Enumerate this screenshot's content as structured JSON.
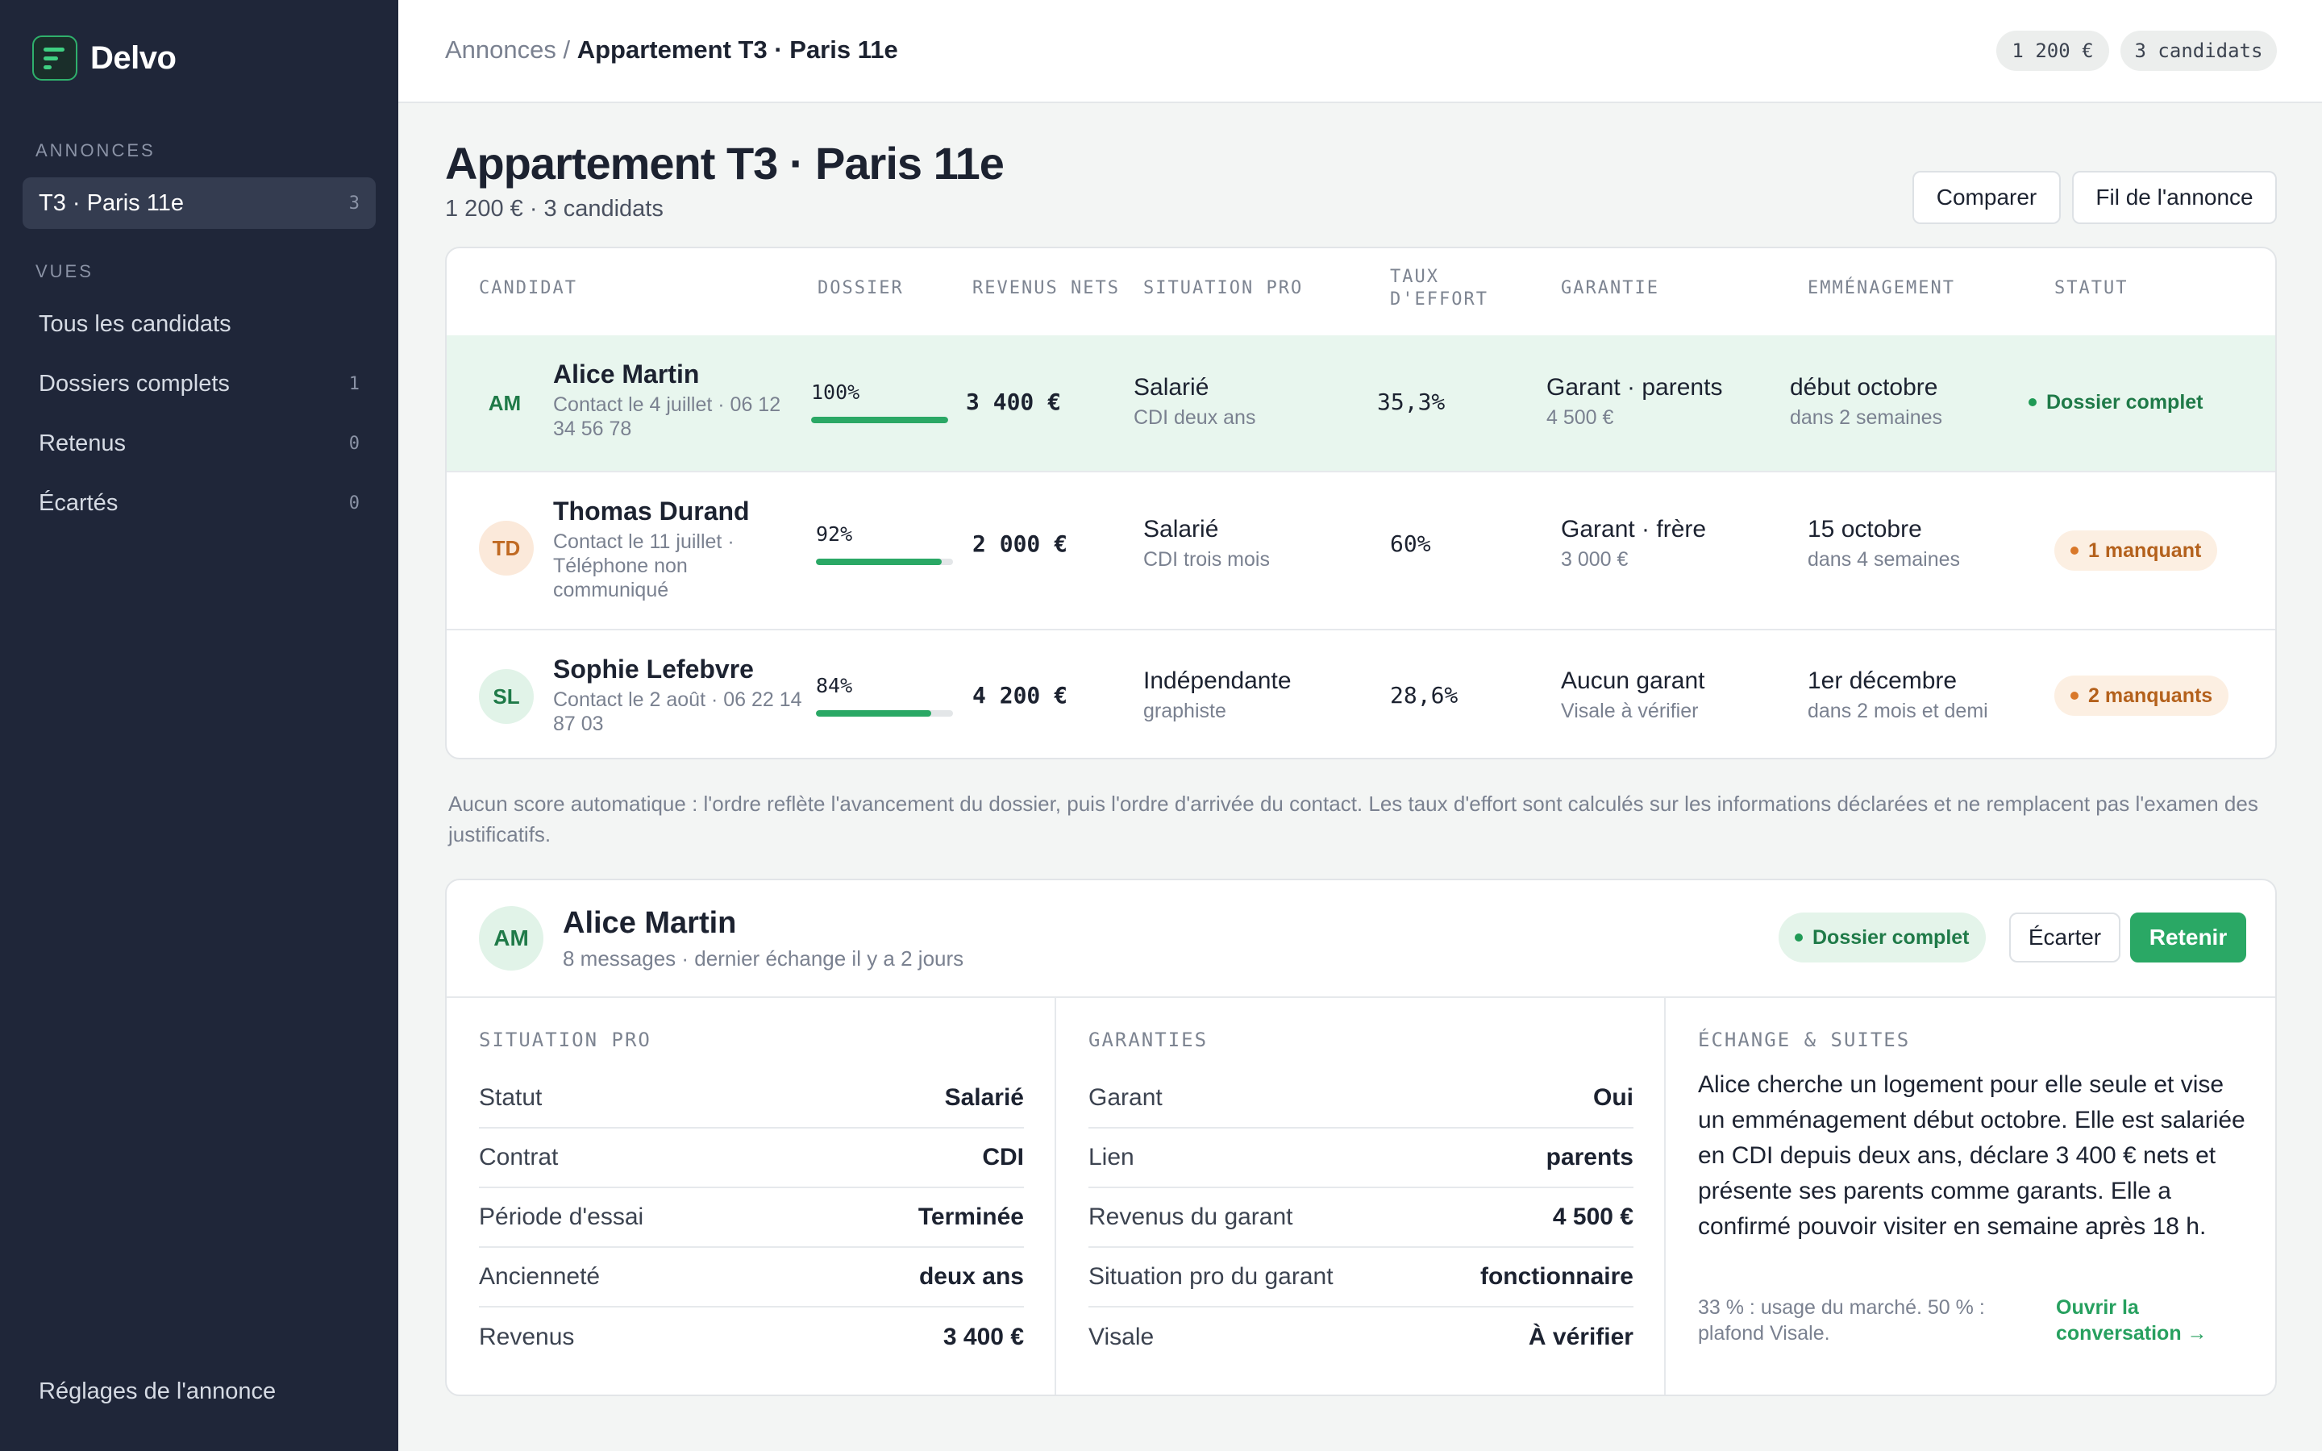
{
  "sidebar": {
    "brand": "Delvo",
    "section_annonces": "ANNONCES",
    "annonce_item": {
      "label": "T3 · Paris 11e",
      "count": "3"
    },
    "section_vues": "VUES",
    "views": [
      {
        "label": "Tous les candidats",
        "count": ""
      },
      {
        "label": "Dossiers complets",
        "count": "1"
      },
      {
        "label": "Retenus",
        "count": "0"
      },
      {
        "label": "Écartés",
        "count": "0"
      }
    ],
    "footer": "Réglages de l'annonce"
  },
  "topbar": {
    "crumb_root": "Annonces",
    "crumb_sep": " / ",
    "crumb_current": "Appartement T3 · Paris 11e",
    "price_pill": "1 200 €",
    "candidates_pill": "3 candidats"
  },
  "header": {
    "title": "Appartement T3 · Paris 11e",
    "subtitle": "1 200 € · 3 candidats",
    "compare_btn": "Comparer",
    "thread_btn": "Fil de l'annonce"
  },
  "table": {
    "columns": [
      "CANDIDAT",
      "DOSSIER",
      "REVENUS NETS",
      "SITUATION PRO",
      "TAUX D'EFFORT",
      "GARANTIE",
      "EMMÉNAGEMENT",
      "STATUT"
    ],
    "col_taux_1": "TAUX",
    "col_taux_2": "D'EFFORT",
    "rows": [
      {
        "initials": "AM",
        "name": "Alice Martin",
        "contact": "Contact le 4 juillet · 06 12 34 56 78",
        "dossier_pct": "100%",
        "dossier_fill": 1.0,
        "revenus": "3 400 €",
        "situation": "Salarié",
        "situation_sub": "CDI deux ans",
        "taux": "35,3%",
        "garantie": "Garant · parents",
        "garantie_sub": "4 500 €",
        "emmenagement": "début octobre",
        "emmenagement_sub": "dans 2 semaines",
        "statut": "Dossier complet"
      },
      {
        "initials": "TD",
        "name": "Thomas Durand",
        "contact": "Contact le 11 juillet · Téléphone non communiqué",
        "dossier_pct": "92%",
        "dossier_fill": 0.92,
        "revenus": "2 000 €",
        "situation": "Salarié",
        "situation_sub": "CDI trois mois",
        "taux": "60%",
        "garantie": "Garant · frère",
        "garantie_sub": "3 000 €",
        "emmenagement": "15 octobre",
        "emmenagement_sub": "dans 4 semaines",
        "statut": "1 manquant"
      },
      {
        "initials": "SL",
        "name": "Sophie Lefebvre",
        "contact": "Contact le 2 août · 06 22 14 87 03",
        "dossier_pct": "84%",
        "dossier_fill": 0.84,
        "revenus": "4 200 €",
        "situation": "Indépendante",
        "situation_sub": "graphiste",
        "taux": "28,6%",
        "garantie": "Aucun garant",
        "garantie_sub": "Visale à vérifier",
        "emmenagement": "1er décembre",
        "emmenagement_sub": "dans 2 mois et demi",
        "statut": "2 manquants"
      }
    ]
  },
  "note": "Aucun score automatique : l'ordre reflète l'avancement du dossier, puis l'ordre d'arrivée du contact. Les taux d'effort sont calculés sur les informations déclarées et ne remplacent pas l'examen des justificatifs.",
  "detail": {
    "initials": "AM",
    "name": "Alice Martin",
    "sub": "8 messages · dernier échange il y a 2 jours",
    "status": "Dossier complet",
    "reject_btn": "Écarter",
    "retain_btn": "Retenir",
    "situation": {
      "title": "SITUATION PRO",
      "items": [
        {
          "k": "Statut",
          "v": "Salarié"
        },
        {
          "k": "Contrat",
          "v": "CDI"
        },
        {
          "k": "Période d'essai",
          "v": "Terminée"
        },
        {
          "k": "Ancienneté",
          "v": "deux ans"
        },
        {
          "k": "Revenus",
          "v": "3 400 €"
        }
      ]
    },
    "garanties": {
      "title": "GARANTIES",
      "items": [
        {
          "k": "Garant",
          "v": "Oui"
        },
        {
          "k": "Lien",
          "v": "parents"
        },
        {
          "k": "Revenus du garant",
          "v": "4 500 €"
        },
        {
          "k": "Situation pro du garant",
          "v": "fonctionnaire"
        },
        {
          "k": "Visale",
          "v": "À vérifier"
        }
      ]
    },
    "echange": {
      "title": "ÉCHANGE & SUITES",
      "message": "Alice cherche un logement pour elle seule et vise un emménagement début octobre. Elle est salariée en CDI depuis deux ans, déclare 3 400 € nets et présente ses parents comme garants. Elle a confirmé pouvoir visiter en semaine après 18 h.",
      "footnote": "33 % : usage du marché. 50 % : plafond Visale.",
      "link": "Ouvrir la conversation →"
    }
  },
  "colors": {
    "sidebar": "#1f2639",
    "accent": "#2aa865",
    "warning": "#d9782a"
  }
}
